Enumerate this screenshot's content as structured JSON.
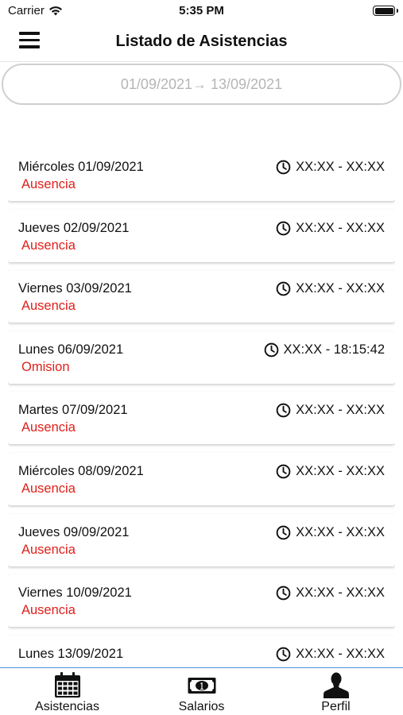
{
  "status_bar": {
    "carrier": "Carrier",
    "time": "5:35 PM"
  },
  "header": {
    "title": "Listado de Asistencias",
    "menu_icon": "hamburger-menu-icon"
  },
  "date_range": {
    "value": "01/09/2021→ 13/09/2021"
  },
  "attendance": [
    {
      "date": "Miércoles 01/09/2021",
      "status": "Ausencia",
      "time": "XX:XX - XX:XX"
    },
    {
      "date": "Jueves 02/09/2021",
      "status": "Ausencia",
      "time": "XX:XX - XX:XX"
    },
    {
      "date": "Viernes 03/09/2021",
      "status": "Ausencia",
      "time": "XX:XX - XX:XX"
    },
    {
      "date": "Lunes 06/09/2021",
      "status": "Omision",
      "time": "XX:XX - 18:15:42"
    },
    {
      "date": "Martes 07/09/2021",
      "status": "Ausencia",
      "time": "XX:XX - XX:XX"
    },
    {
      "date": "Miércoles 08/09/2021",
      "status": "Ausencia",
      "time": "XX:XX - XX:XX"
    },
    {
      "date": "Jueves 09/09/2021",
      "status": "Ausencia",
      "time": "XX:XX - XX:XX"
    },
    {
      "date": "Viernes 10/09/2021",
      "status": "Ausencia",
      "time": "XX:XX - XX:XX"
    },
    {
      "date": "Lunes 13/09/2021",
      "status": "",
      "time": "XX:XX - XX:XX"
    }
  ],
  "tabs": [
    {
      "label": "Asistencias",
      "icon": "calendar-icon"
    },
    {
      "label": "Salarios",
      "icon": "money-icon"
    },
    {
      "label": "Perfil",
      "icon": "user-icon"
    }
  ],
  "colors": {
    "status_red": "#e0201a",
    "tab_bar_border": "#4a90d9",
    "placeholder_gray": "#b5b5b5"
  }
}
